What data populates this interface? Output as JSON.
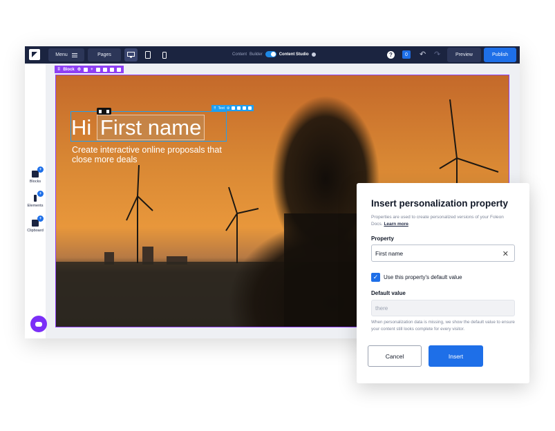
{
  "topbar": {
    "menu_label": "Menu",
    "pages_label": "Pages",
    "mode_left": "Content",
    "mode_mid": "Builder",
    "mode_right": "Content Studio",
    "notif_count": "0",
    "preview_label": "Preview",
    "publish_label": "Publish"
  },
  "rail": {
    "items": [
      {
        "label": "Blocks",
        "icon": "blocks-icon"
      },
      {
        "label": "Elements",
        "icon": "elements-icon"
      },
      {
        "label": "Clipboard",
        "icon": "clipboard-icon"
      }
    ]
  },
  "canvas": {
    "block_label": "Block",
    "text_label": "Text",
    "headline_prefix": "Hi",
    "headline_token": "First name",
    "subheadline": "Create interactive online proposals that close more deals"
  },
  "dialog": {
    "title": "Insert personalization property",
    "description": "Properties are used to create personalized versions of your Foleon Docs.",
    "learn_more": "Learn more",
    "property_label": "Property",
    "property_value": "First name",
    "checkbox_label": "Use this property's default value",
    "checkbox_checked": true,
    "default_label": "Default value",
    "default_placeholder": "there",
    "help_text": "When personalization data is missing, we show the default value to ensure your content still looks complete for every visitor.",
    "cancel_label": "Cancel",
    "insert_label": "Insert"
  },
  "colors": {
    "topbar": "#1b2440",
    "accent_blue": "#1e6fe8",
    "block_purple": "#8e3ff5",
    "text_tool_blue": "#1e9ff2"
  }
}
